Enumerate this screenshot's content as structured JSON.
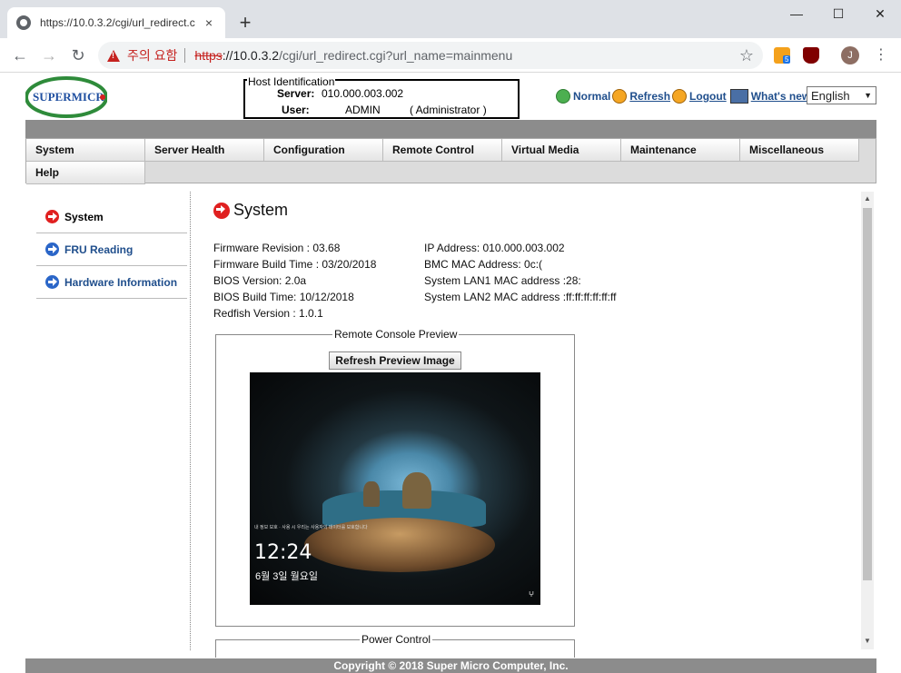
{
  "browser": {
    "tab_title": "https://10.0.3.2/cgi/url_redirect.c",
    "tab_close": "×",
    "new_tab": "+",
    "window_min": "—",
    "window_max": "☐",
    "window_close": "✕",
    "back": "←",
    "forward": "→",
    "reload": "↻",
    "security_warning": "주의 요함",
    "url_scheme": "https",
    "url_host": "://10.0.3.2",
    "url_path": "/cgi/url_redirect.cgi?url_name=mainmenu",
    "star": "☆",
    "rss_badge": "5",
    "avatar_letter": "J",
    "menu": "⋮"
  },
  "header": {
    "logo_text": "SUPERMICR",
    "host_legend": "Host Identification",
    "server_label": "Server:",
    "server_value": "010.000.003.002",
    "user_label": "User:",
    "user_value": "ADMIN",
    "user_role": "( Administrator )",
    "links": {
      "normal": "Normal",
      "refresh": "Refresh",
      "logout": "Logout",
      "whats_new": "What's  new"
    },
    "language": "English",
    "language_arrow": "▼"
  },
  "menu": {
    "items": [
      "System",
      "Server Health",
      "Configuration",
      "Remote Control",
      "Virtual Media",
      "Maintenance",
      "Miscellaneous"
    ],
    "help": "Help"
  },
  "sidebar": {
    "items": [
      "System",
      "FRU Reading",
      "Hardware Information"
    ]
  },
  "content": {
    "title": "System",
    "left": [
      "Firmware Revision :  03.68",
      "Firmware Build Time :  03/20/2018",
      "BIOS Version: 2.0a",
      "BIOS Build Time: 10/12/2018",
      "Redfish Version : 1.0.1"
    ],
    "right": [
      "IP Address:  010.000.003.002",
      "BMC MAC Address:  0c:(",
      "System LAN1 MAC address :28:",
      "System LAN2 MAC address :ff:ff:ff:ff:ff:ff"
    ],
    "console_legend": "Remote Console Preview",
    "refresh_button": "Refresh Preview Image",
    "preview_tiny_text": "내 정보 보호 · 사용 시 우리는 사용자의 데이터를 보호합니다",
    "preview_time": "12:24",
    "preview_date": "6월 3일 월요일",
    "preview_net": "ⵖ",
    "power_legend": "Power Control"
  },
  "footer": {
    "copyright": "Copyright © 2018 Super Micro Computer, Inc."
  },
  "colors": {
    "red_icon": "#e02020",
    "blue_icon": "#2b66c8",
    "menubar_gray": "#8c8c8c"
  }
}
